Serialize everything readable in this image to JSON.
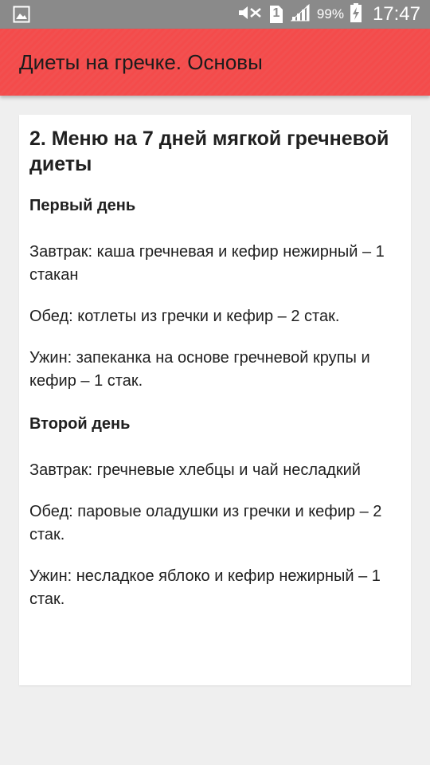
{
  "status_bar": {
    "battery_percent": "99%",
    "sim_slot": "1",
    "time": "17:47",
    "icons": [
      "gallery-icon",
      "mute-icon",
      "sim-icon",
      "signal-icon",
      "battery-charging-icon"
    ]
  },
  "app_bar": {
    "title": "Диеты на гречке. Основы",
    "color": "#f44b4b"
  },
  "article": {
    "title": "2. Меню на 7 дней мягкой гречневой диеты",
    "days": [
      {
        "heading": "Первый день",
        "meals": [
          "Завтрак: каша гречневая и кефир нежирный – 1 стакан",
          "Обед: котлеты из гречки и кефир – 2 стак.",
          "Ужин: запеканка на основе гречневой крупы и кефир – 1 стак."
        ]
      },
      {
        "heading": "Второй день",
        "meals": [
          "Завтрак: гречневые хлебцы и чай несладкий",
          "Обед: паровые оладушки из гречки и кефир – 2 стак.",
          "Ужин: несладкое яблоко и кефир нежирный – 1 стак."
        ]
      }
    ]
  }
}
